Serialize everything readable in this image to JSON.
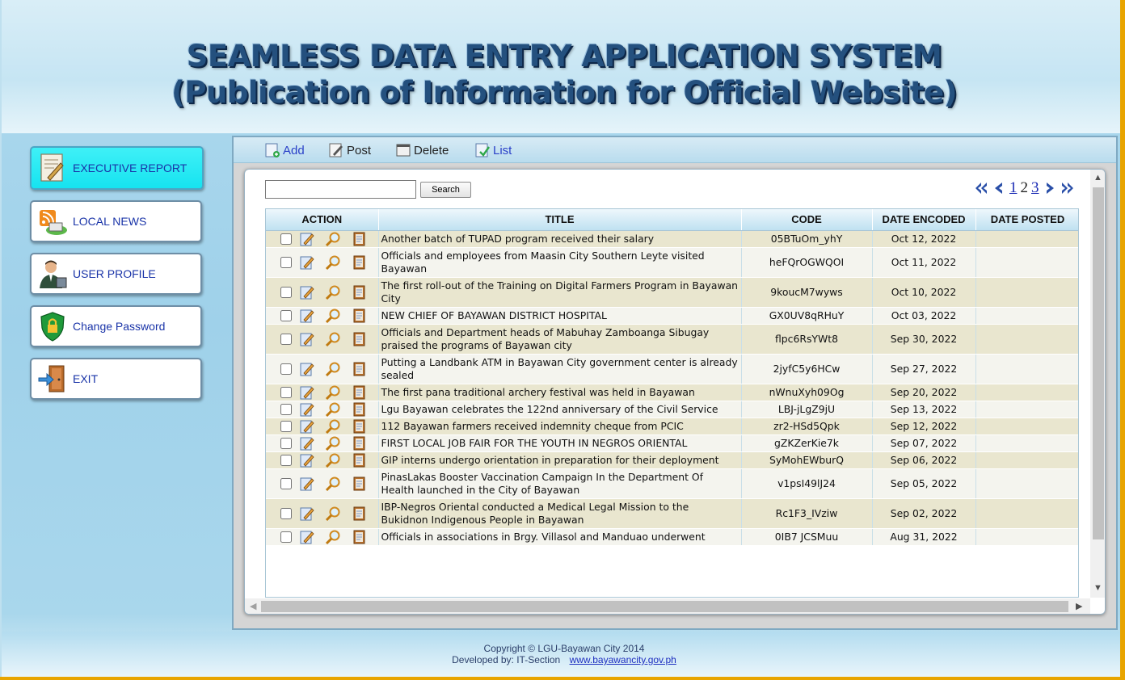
{
  "header": {
    "title_line1": "SEAMLESS DATA ENTRY APPLICATION SYSTEM",
    "title_line2": "(Publication of Information for Official Website)"
  },
  "sidebar": {
    "items": [
      {
        "label": "EXECUTIVE REPORT",
        "icon": "report-icon",
        "active": true
      },
      {
        "label": "LOCAL NEWS",
        "icon": "news-icon",
        "active": false
      },
      {
        "label": "USER PROFILE",
        "icon": "user-icon",
        "active": false
      },
      {
        "label": "Change Password",
        "icon": "shield-lock-icon",
        "active": false
      },
      {
        "label": "EXIT",
        "icon": "exit-door-icon",
        "active": false
      }
    ]
  },
  "toolbar": {
    "add_label": "Add",
    "post_label": "Post",
    "delete_label": "Delete",
    "list_label": "List"
  },
  "search": {
    "value": "",
    "placeholder": "",
    "button_label": "Search"
  },
  "pager": {
    "pages": [
      "1",
      "2",
      "3"
    ],
    "current": "2"
  },
  "table": {
    "columns": [
      "ACTION",
      "TITLE",
      "CODE",
      "DATE ENCODED",
      "DATE POSTED"
    ],
    "rows": [
      {
        "title": "Another batch of TUPAD program received their salary",
        "code": "05BTuOm_yhY",
        "encoded": "Oct 12, 2022",
        "posted": ""
      },
      {
        "title": "Officials and employees from Maasin City Southern Leyte visited Bayawan",
        "code": "heFQrOGWQOI",
        "encoded": "Oct 11, 2022",
        "posted": ""
      },
      {
        "title": "The first roll-out of the Training on Digital Farmers Program in Bayawan City",
        "code": "9koucM7wyws",
        "encoded": "Oct 10, 2022",
        "posted": ""
      },
      {
        "title": "NEW CHIEF OF BAYAWAN DISTRICT HOSPITAL",
        "code": "GX0UV8qRHuY",
        "encoded": "Oct 03, 2022",
        "posted": ""
      },
      {
        "title": "Officials and Department heads of Mabuhay Zamboanga Sibugay praised the programs of Bayawan city",
        "code": "flpc6RsYWt8",
        "encoded": "Sep 30, 2022",
        "posted": ""
      },
      {
        "title": "Putting a Landbank ATM in Bayawan City government center is already sealed",
        "code": "2jyfC5y6HCw",
        "encoded": "Sep 27, 2022",
        "posted": ""
      },
      {
        "title": "The first pana traditional archery festival was held in Bayawan",
        "code": "nWnuXyh09Og",
        "encoded": "Sep 20, 2022",
        "posted": ""
      },
      {
        "title": "Lgu Bayawan celebrates the 122nd anniversary of the Civil Service",
        "code": "LBJ-jLgZ9jU",
        "encoded": "Sep 13, 2022",
        "posted": ""
      },
      {
        "title": "112 Bayawan farmers received indemnity cheque from PCIC",
        "code": "zr2-HSd5Qpk",
        "encoded": "Sep 12, 2022",
        "posted": ""
      },
      {
        "title": "FIRST LOCAL JOB FAIR FOR THE YOUTH IN NEGROS ORIENTAL",
        "code": "gZKZerKie7k",
        "encoded": "Sep 07, 2022",
        "posted": ""
      },
      {
        "title": "GIP interns undergo orientation in preparation for their deployment",
        "code": "SyMohEWburQ",
        "encoded": "Sep 06, 2022",
        "posted": ""
      },
      {
        "title": "PinasLakas Booster Vaccination Campaign In the Department Of Health launched in the City of Bayawan",
        "code": "v1psI49lJ24",
        "encoded": "Sep 05, 2022",
        "posted": ""
      },
      {
        "title": "IBP-Negros Oriental conducted a Medical Legal Mission to the Bukidnon Indigenous People in Bayawan",
        "code": "Rc1F3_IVziw",
        "encoded": "Sep 02, 2022",
        "posted": ""
      },
      {
        "title": "Officials in associations in Brgy. Villasol and Manduao underwent",
        "code": "0IB7 JCSMuu",
        "encoded": "Aug 31, 2022",
        "posted": ""
      }
    ]
  },
  "footer": {
    "copyright": "Copyright © LGU-Bayawan City 2014",
    "developed_by": "Developed by: IT-Section",
    "site": "www.bayawancity.gov.ph"
  }
}
